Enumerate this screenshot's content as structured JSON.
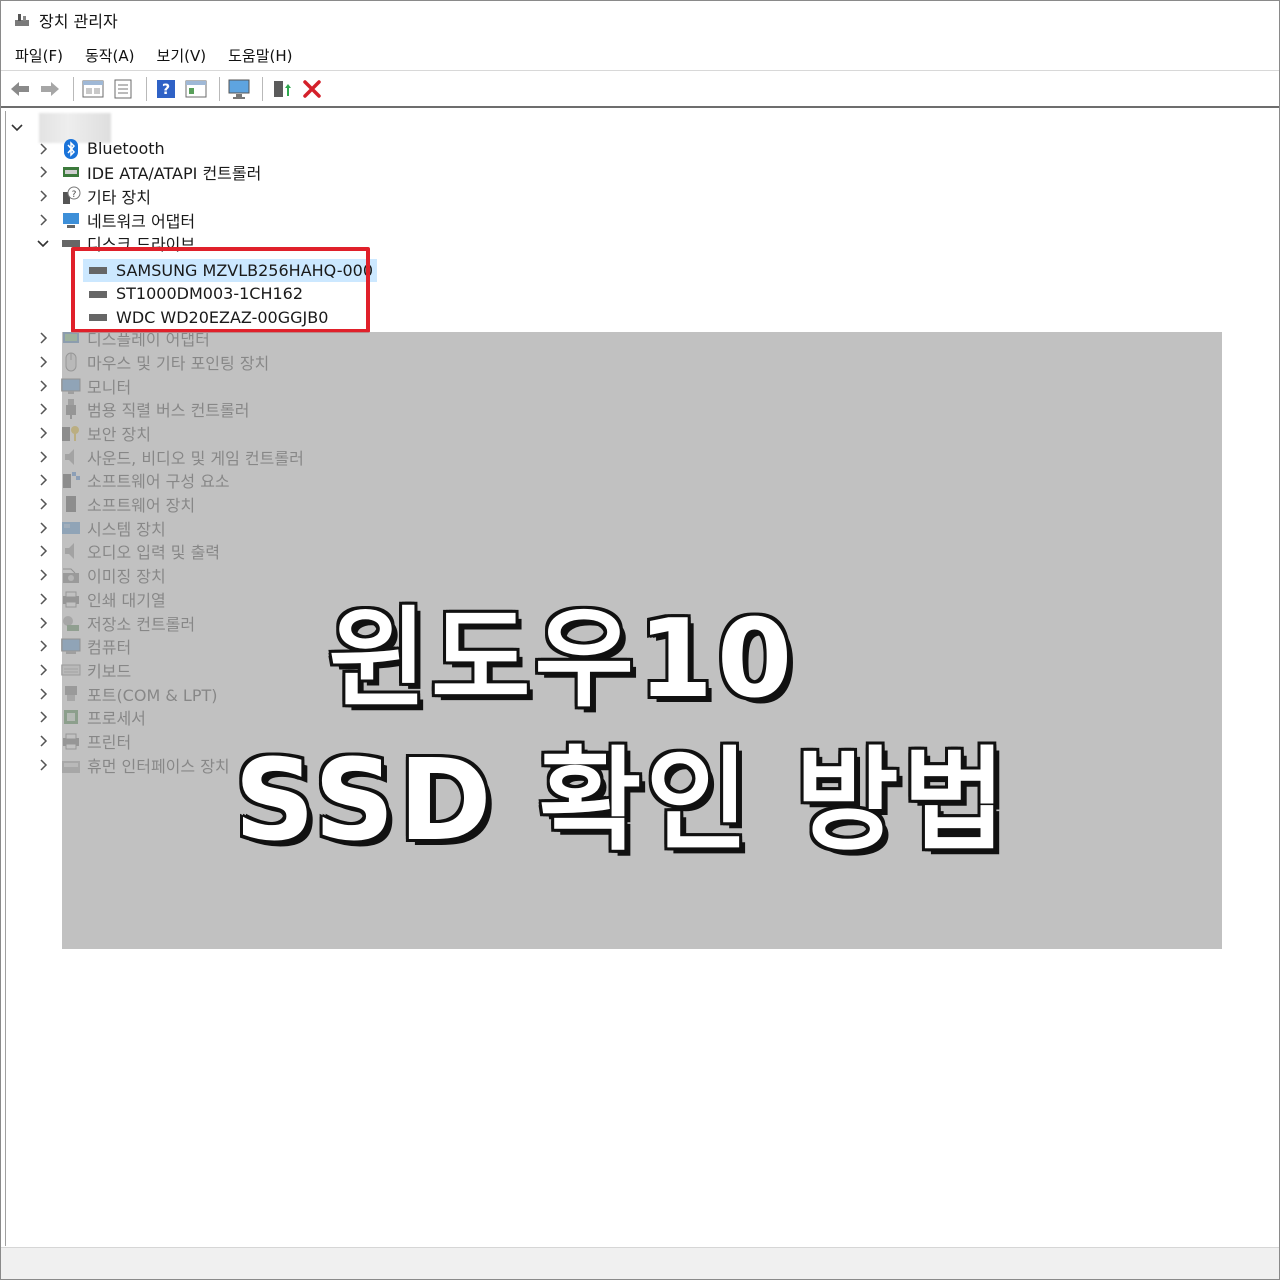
{
  "window": {
    "title": "장치 관리자"
  },
  "menubar": {
    "items": [
      "파일(F)",
      "동작(A)",
      "보기(V)",
      "도움말(H)"
    ]
  },
  "toolbar": {
    "buttons": [
      "back-icon",
      "forward-icon",
      "properties-grid-icon",
      "properties-sheet-icon",
      "help-icon",
      "view-icon",
      "monitor-icon",
      "update-driver-icon",
      "uninstall-icon"
    ]
  },
  "tree": {
    "categories": [
      {
        "label": "Bluetooth",
        "icon": "bluetooth-icon",
        "expanded": false
      },
      {
        "label": "IDE ATA/ATAPI 컨트롤러",
        "icon": "ide-controller-icon",
        "expanded": false
      },
      {
        "label": "기타 장치",
        "icon": "unknown-device-icon",
        "expanded": false
      },
      {
        "label": "네트워크 어댑터",
        "icon": "network-adapter-icon",
        "expanded": false
      },
      {
        "label": "디스크 드라이브",
        "icon": "disk-drive-icon",
        "expanded": true
      },
      {
        "label": "디스플레이 어댑터",
        "icon": "display-adapter-icon",
        "expanded": false
      },
      {
        "label": "마우스 및 기타 포인팅 장치",
        "icon": "mouse-icon",
        "expanded": false
      },
      {
        "label": "모니터",
        "icon": "monitor-icon",
        "expanded": false
      },
      {
        "label": "범용 직렬 버스 컨트롤러",
        "icon": "usb-icon",
        "expanded": false
      },
      {
        "label": "보안 장치",
        "icon": "security-device-icon",
        "expanded": false
      },
      {
        "label": "사운드, 비디오 및 게임 컨트롤러",
        "icon": "speaker-icon",
        "expanded": false
      },
      {
        "label": "소프트웨어 구성 요소",
        "icon": "software-component-icon",
        "expanded": false
      },
      {
        "label": "소프트웨어 장치",
        "icon": "software-device-icon",
        "expanded": false
      },
      {
        "label": "시스템 장치",
        "icon": "system-device-icon",
        "expanded": false
      },
      {
        "label": "오디오 입력 및 출력",
        "icon": "audio-icon",
        "expanded": false
      },
      {
        "label": "이미징 장치",
        "icon": "camera-icon",
        "expanded": false
      },
      {
        "label": "인쇄 대기열",
        "icon": "print-queue-icon",
        "expanded": false
      },
      {
        "label": "저장소 컨트롤러",
        "icon": "storage-controller-icon",
        "expanded": false
      },
      {
        "label": "컴퓨터",
        "icon": "computer-icon",
        "expanded": false
      },
      {
        "label": "키보드",
        "icon": "keyboard-icon",
        "expanded": false
      },
      {
        "label": "포트(COM & LPT)",
        "icon": "port-icon",
        "expanded": false
      },
      {
        "label": "프로세서",
        "icon": "processor-icon",
        "expanded": false
      },
      {
        "label": "프린터",
        "icon": "printer-icon",
        "expanded": false
      },
      {
        "label": "휴먼 인터페이스 장치",
        "icon": "hid-icon",
        "expanded": false
      }
    ],
    "disk_drives": [
      {
        "label": "SAMSUNG MZVLB256HAHQ-000",
        "selected": true
      },
      {
        "label": "ST1000DM003-1CH162",
        "selected": false
      },
      {
        "label": "WDC WD20EZAZ-00GGJB0",
        "selected": false
      }
    ]
  },
  "overlay": {
    "line1": "윈도우10",
    "line2": "SSD 확인 방법"
  },
  "colors": {
    "highlight": "#e0202a",
    "selection": "#cce8ff",
    "overlay": "#bfbfbf"
  }
}
